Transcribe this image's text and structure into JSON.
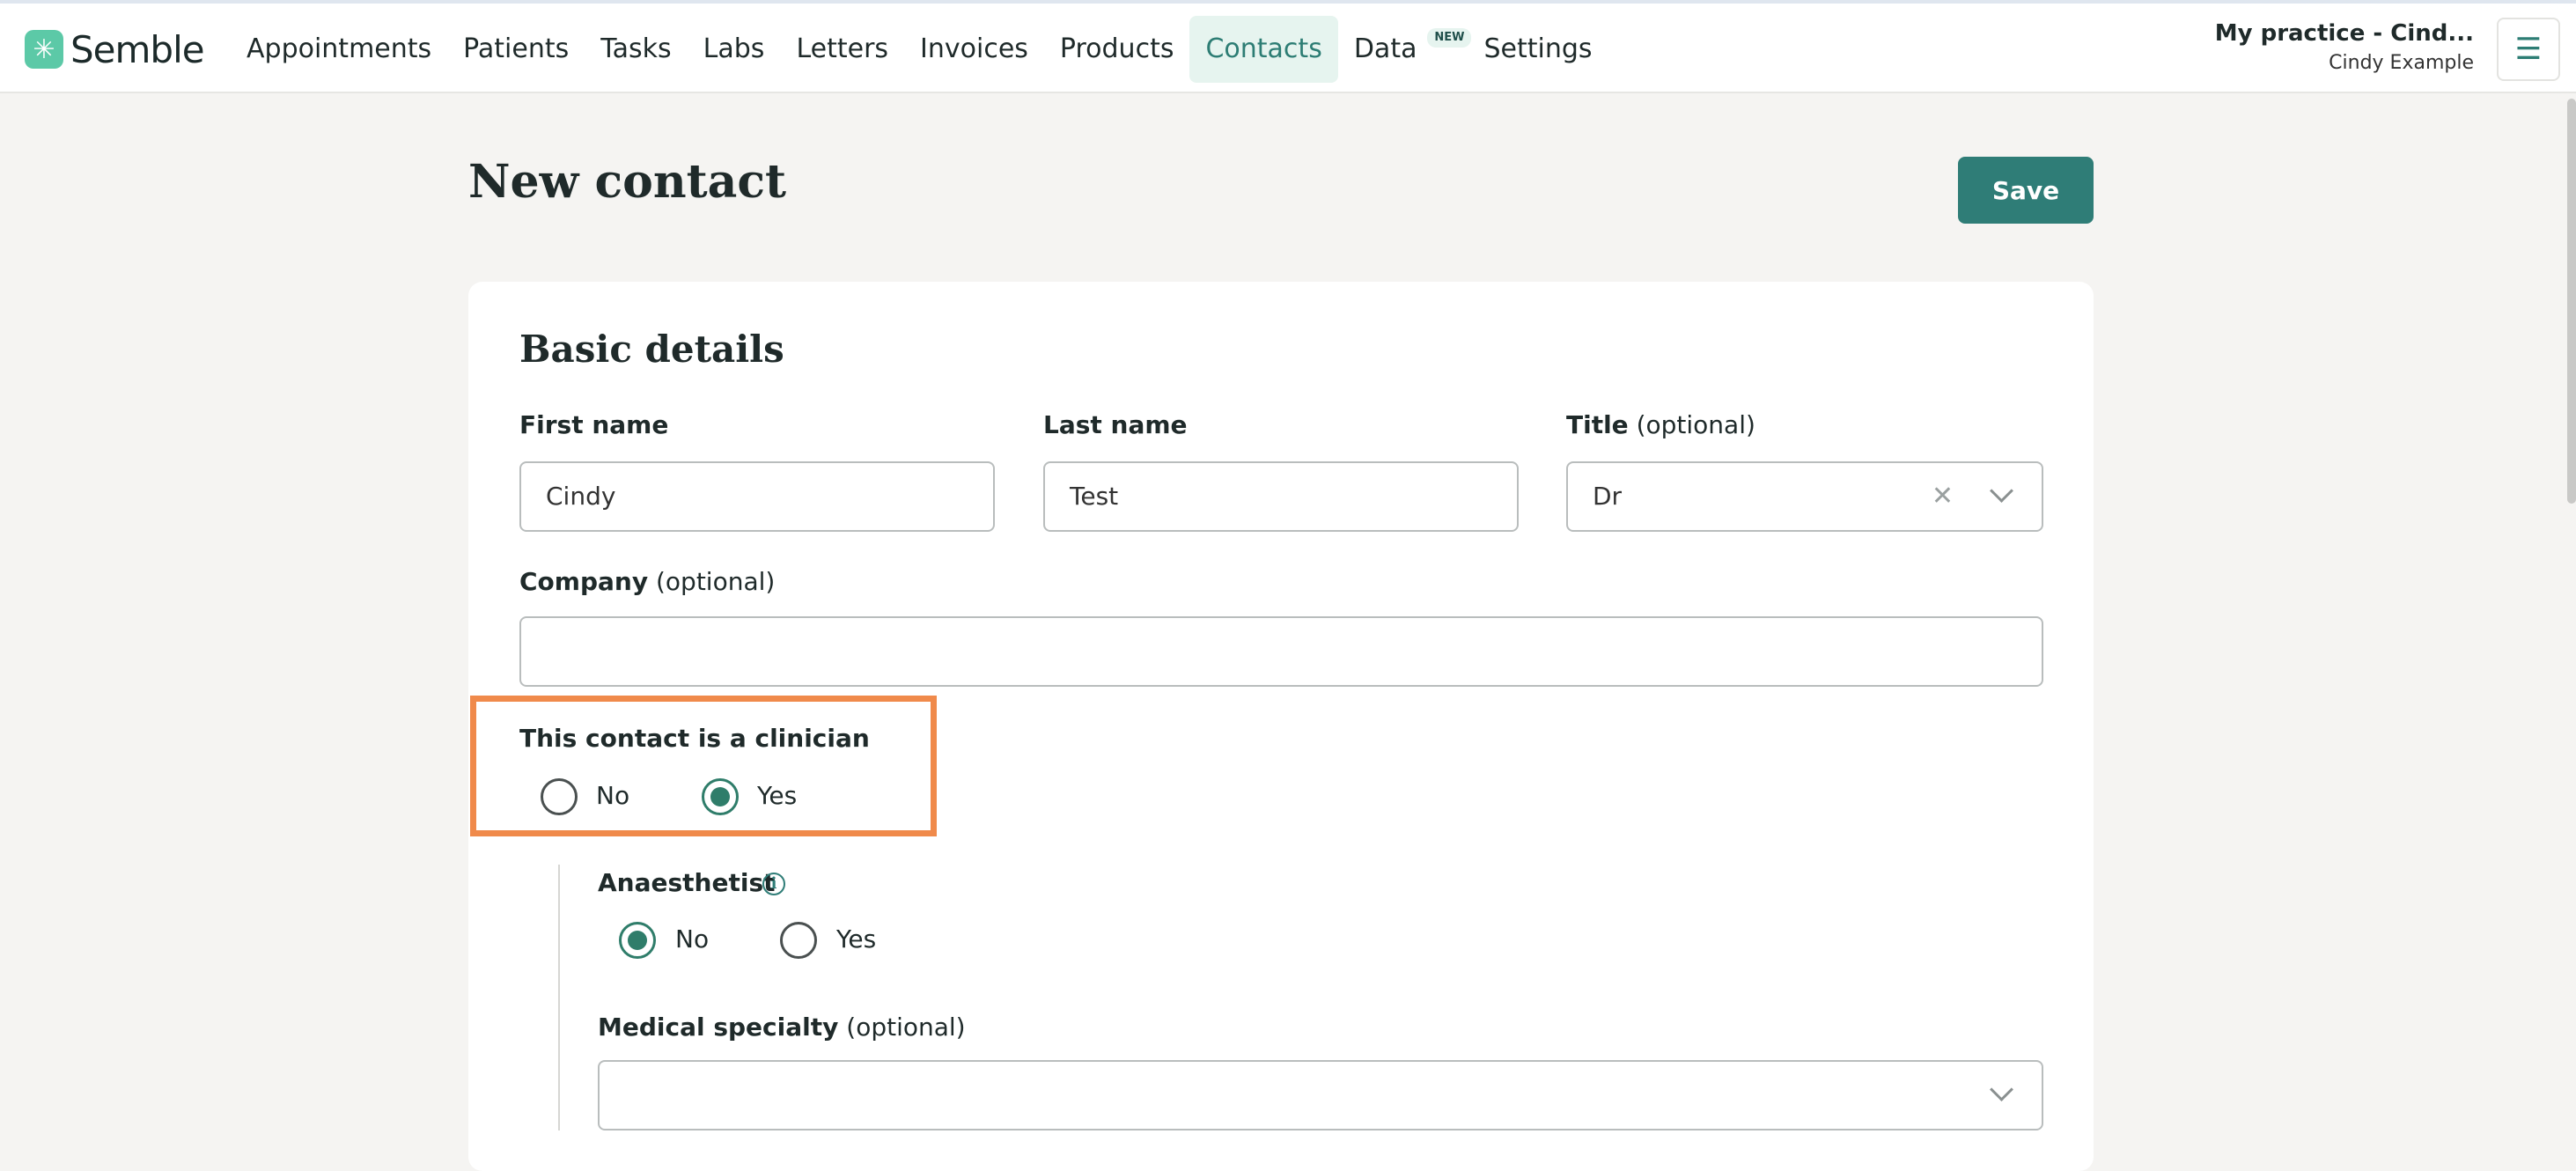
{
  "brand": {
    "name": "Semble",
    "logo_color": "#5cc9a7"
  },
  "nav": {
    "items": [
      {
        "label": "Appointments"
      },
      {
        "label": "Patients"
      },
      {
        "label": "Tasks"
      },
      {
        "label": "Labs"
      },
      {
        "label": "Letters"
      },
      {
        "label": "Invoices"
      },
      {
        "label": "Products"
      },
      {
        "label": "Contacts",
        "active": true
      },
      {
        "label": "Data",
        "badge": "NEW"
      },
      {
        "label": "Settings"
      }
    ]
  },
  "account": {
    "practice": "My practice - Cind...",
    "user": "Cindy Example"
  },
  "page": {
    "title": "New contact",
    "save_label": "Save"
  },
  "basic_details": {
    "title": "Basic details",
    "first_name": {
      "label": "First name",
      "value": "Cindy"
    },
    "last_name": {
      "label": "Last name",
      "value": "Test"
    },
    "title_field": {
      "label": "Title",
      "optional": "(optional)",
      "value": "Dr"
    },
    "company": {
      "label": "Company",
      "optional": "(optional)",
      "value": ""
    },
    "clinician": {
      "label": "This contact is a clinician",
      "options": [
        "No",
        "Yes"
      ],
      "selected": "Yes"
    },
    "anaesthetist": {
      "label": "Anaesthetist",
      "options": [
        "No",
        "Yes"
      ],
      "selected": "No"
    },
    "medical_specialty": {
      "label": "Medical specialty",
      "optional": "(optional)",
      "value": ""
    }
  },
  "colors": {
    "accent": "#2f7d77",
    "highlight": "#f08a4b",
    "active_nav_bg": "#e6f4ef"
  }
}
